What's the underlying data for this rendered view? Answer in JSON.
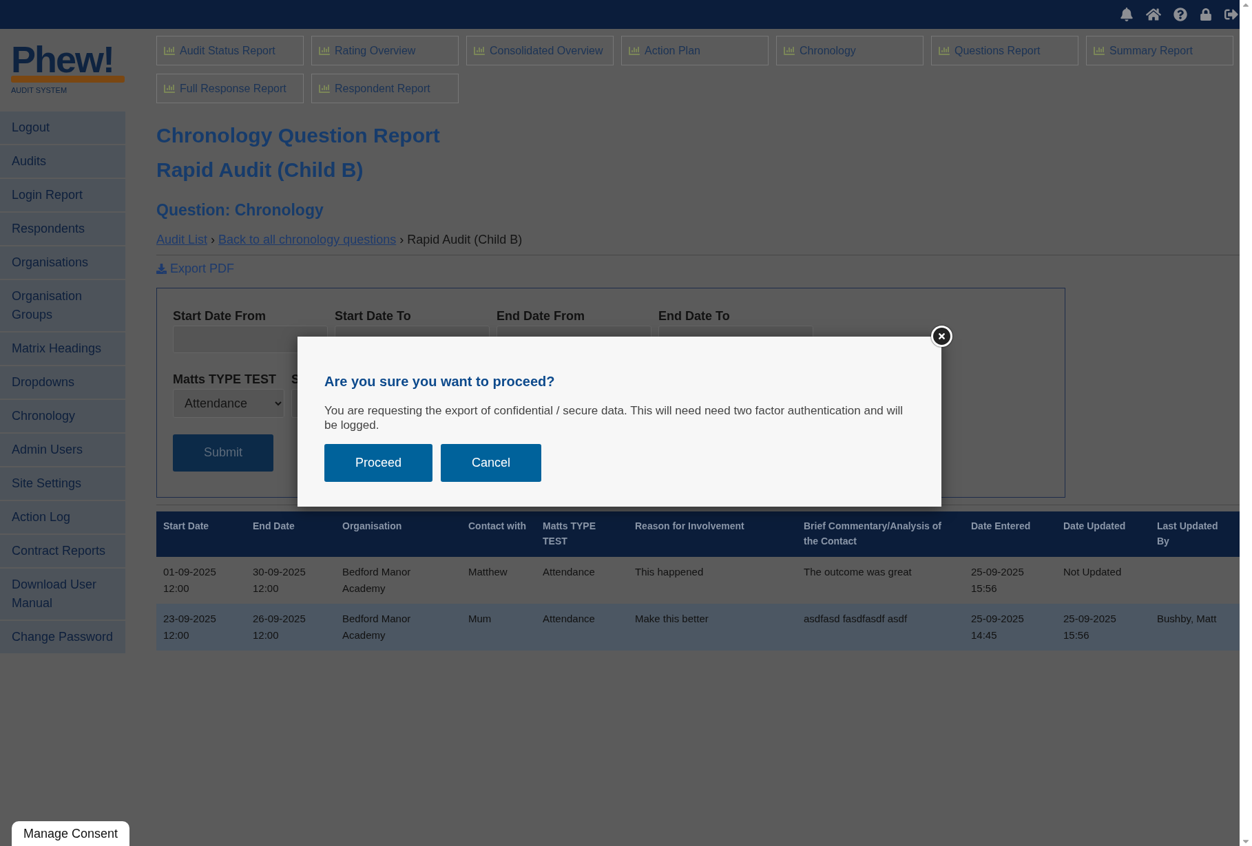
{
  "logo": {
    "name": "Phew!",
    "subtitle": "AUDIT SYSTEM"
  },
  "report_tabs": [
    {
      "label": "Audit Status Report"
    },
    {
      "label": "Rating Overview"
    },
    {
      "label": "Consolidated Overview"
    },
    {
      "label": "Action Plan"
    },
    {
      "label": "Chronology"
    },
    {
      "label": "Questions Report"
    },
    {
      "label": "Summary Report"
    },
    {
      "label": "Full Response Report"
    },
    {
      "label": "Respondent Report"
    }
  ],
  "sidebar": {
    "items": [
      "Logout",
      "Audits",
      "Login Report",
      "Respondents",
      "Organisations",
      "Organisation Groups",
      "Matrix Headings",
      "Dropdowns",
      "Chronology",
      "Admin Users",
      "Site Settings",
      "Action Log",
      "Contract Reports",
      "Download User Manual",
      "Change Password"
    ]
  },
  "page": {
    "title": "Chronology Question Report",
    "subtitle": "Rapid Audit (Child B)",
    "question": "Question: Chronology"
  },
  "breadcrumb_separator": "›",
  "breadcrumb": [
    {
      "label": "Audit List",
      "kind": "link"
    },
    {
      "label": "Back to all chronology questions",
      "kind": "link"
    },
    {
      "label": "Rapid Audit (Child B)",
      "kind": "text"
    }
  ],
  "export_link": "Export PDF",
  "filters": {
    "date_fields": [
      {
        "label": "Start Date From"
      },
      {
        "label": "Start Date To"
      },
      {
        "label": "End Date From"
      },
      {
        "label": "End Date To"
      }
    ],
    "selects": [
      {
        "label": "Matts TYPE TEST",
        "value": "Attendance"
      },
      {
        "label": "S"
      }
    ],
    "submit": "Submit"
  },
  "table": {
    "columns": [
      "Start Date",
      "End Date",
      "Organisation",
      "Contact with",
      "Matts TYPE TEST",
      "Reason for Involvement",
      "Brief Commentary/Analysis of the Contact",
      "Date Entered",
      "Date Updated",
      "Last Updated By"
    ],
    "rows": [
      [
        "01-09-2025 12:00",
        "30-09-2025 12:00",
        "Bedford Manor Academy",
        "Matthew",
        "Attendance",
        "This happened",
        "The outcome was great",
        "25-09-2025 15:56",
        "Not Updated",
        ""
      ],
      [
        "23-09-2025 12:00",
        "26-09-2025 12:00",
        "Bedford Manor Academy",
        "Mum",
        "Attendance",
        "Make this better",
        "asdfasd fasdfasdf asdf",
        "25-09-2025 14:45",
        "25-09-2025 15:56",
        "Bushby, Matt"
      ]
    ]
  },
  "dialog": {
    "title": "Are you sure you want to proceed?",
    "message": "You are requesting the export of confidential / secure data. This will need need two factor authentication and will be logged.",
    "buttons": [
      "Proceed",
      "Cancel"
    ]
  },
  "consent_button": "Manage Consent"
}
